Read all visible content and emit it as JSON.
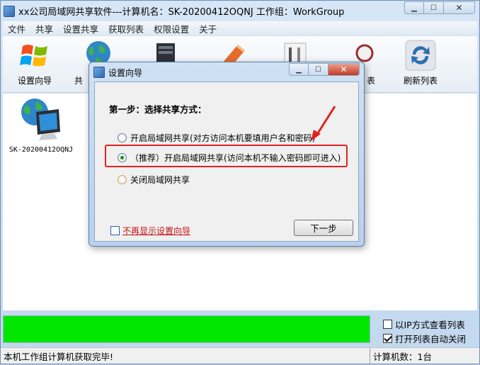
{
  "window": {
    "title": "xx公司局域网共享软件---计算机名：SK-20200412OQNJ  工作组：WorkGroup"
  },
  "menu": [
    "文件",
    "共享",
    "设置共享",
    "获取列表",
    "权限设置",
    "关于"
  ],
  "toolbar": {
    "setup_wizard": "设置向导",
    "share_partial": "共",
    "list_partial": "表",
    "refresh_list": "刷新列表"
  },
  "computers": [
    {
      "name": "SK-20200412OQNJ"
    }
  ],
  "dialog": {
    "title": "设置向导",
    "step_title": "第一步：选择共享方式：",
    "options": [
      {
        "label": "开启局域网共享(对方访问本机要填用户名和密码)",
        "selected": false
      },
      {
        "label": "（推荐）开启局域网共享(访问本机不输入密码即可进入)",
        "selected": true
      },
      {
        "label": "关闭局域网共享",
        "selected": false
      }
    ],
    "dont_show_again": "不再显示设置向导",
    "dont_show_checked": false,
    "next_button": "下一步"
  },
  "options_panel": {
    "view_by_ip": "以IP方式查看列表",
    "view_by_ip_checked": false,
    "auto_close": "打开列表自动关闭",
    "auto_close_checked": true
  },
  "status": {
    "message": "本机工作组计算机获取完毕!",
    "computer_count": "计算机数：1台"
  },
  "colors": {
    "progress_fill": "#00e600",
    "highlight_border": "#e02222",
    "arrow": "#e02222"
  },
  "icons": {
    "app": "app-icon",
    "setup_wizard": "windows-logo-icon",
    "share": "globe-icon",
    "refresh": "refresh-icon",
    "computer": "globe-computer-icon"
  }
}
